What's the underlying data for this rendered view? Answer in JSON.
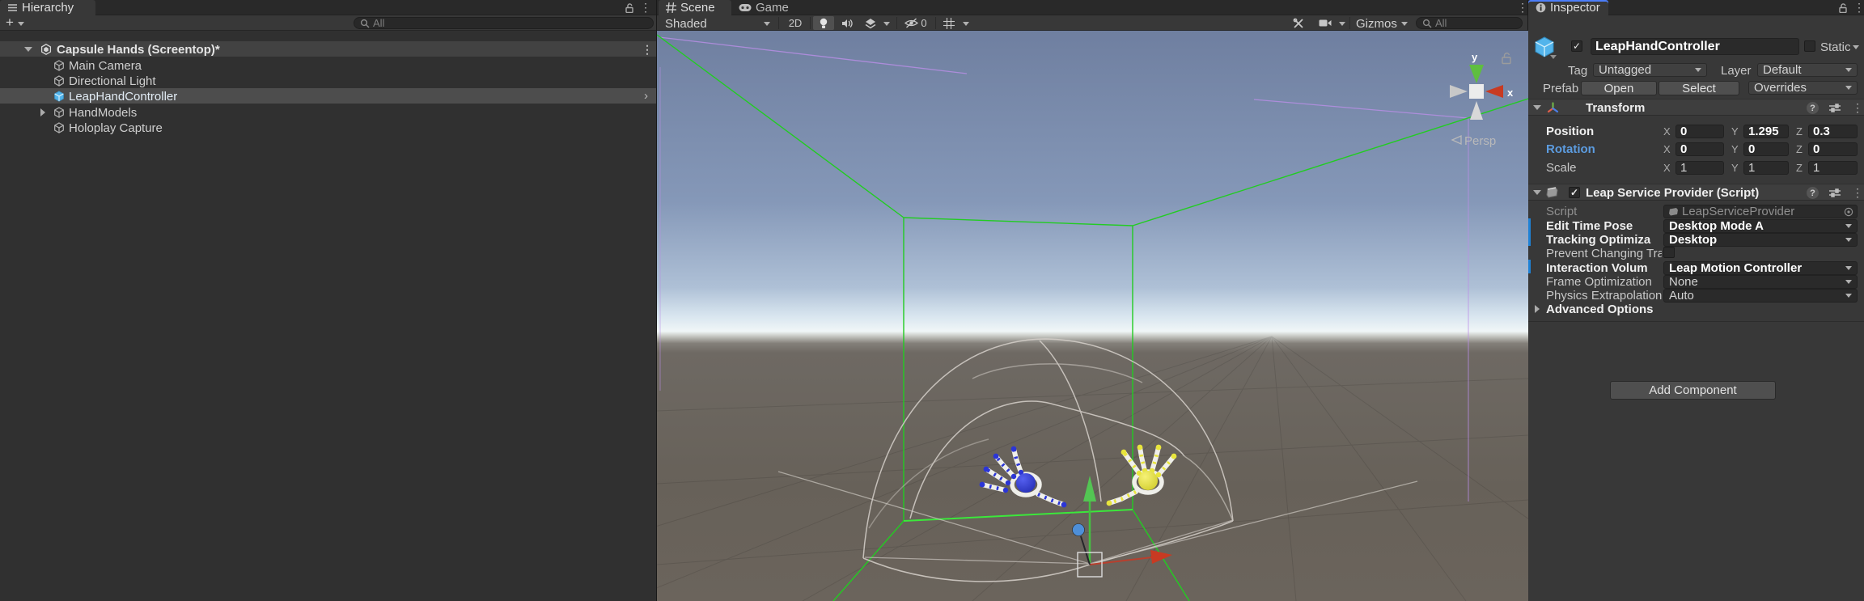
{
  "colors": {
    "accent": "#53B4EB",
    "focus_line": "#4C7EFA",
    "rotation_label": "#5C9CE0",
    "override_bar": "#1F82D6",
    "green_wire": "#22CC22",
    "green_wire_bright": "#3BE83B",
    "purple_wire": "#BB8FE8",
    "hand_blue": "#2B35D6",
    "hand_yellow": "#E8E53C",
    "axis_green": "#5FBE3F",
    "axis_red": "#C83A22",
    "axis_blue": "#4E8FD8"
  },
  "hierarchy": {
    "tab": "Hierarchy",
    "create_button": "+",
    "search_placeholder": "All",
    "scene": {
      "label": "Capsule Hands (Screentop)*"
    },
    "items": [
      {
        "label": "Main Camera"
      },
      {
        "label": "Directional Light"
      },
      {
        "label": "LeapHandController"
      },
      {
        "label": "HandModels"
      },
      {
        "label": "Holoplay Capture"
      }
    ]
  },
  "scene_view": {
    "tab_scene": "Scene",
    "tab_game": "Game",
    "toolbar": {
      "shading": "Shaded",
      "btn_2d": "2D",
      "hidden_count": "0",
      "gizmos": "Gizmos",
      "search_placeholder": "All"
    },
    "viewport": {
      "persp": "Persp",
      "axis_x": "x",
      "axis_y": "y"
    }
  },
  "inspector": {
    "tab": "Inspector",
    "header": {
      "name": "LeapHandController",
      "static": "Static",
      "tag": "Tag",
      "tag_value": "Untagged",
      "layer": "Layer",
      "layer_value": "Default",
      "prefab": "Prefab",
      "open": "Open",
      "select": "Select",
      "overrides": "Overrides"
    },
    "transform": {
      "title": "Transform",
      "axis": {
        "x": "X",
        "y": "Y",
        "z": "Z"
      },
      "position": {
        "label": "Position",
        "x": "0",
        "y": "1.295",
        "z": "0.3"
      },
      "rotation": {
        "label": "Rotation",
        "x": "0",
        "y": "0",
        "z": "0"
      },
      "scale": {
        "label": "Scale",
        "x": "1",
        "y": "1",
        "z": "1"
      }
    },
    "leap": {
      "title": "Leap Service Provider (Script)",
      "script_label": "Script",
      "script_value": "LeapServiceProvider",
      "rows": [
        {
          "label": "Edit Time Pose",
          "value": "Desktop Mode A"
        },
        {
          "label": "Tracking Optimiza",
          "value": "Desktop"
        },
        {
          "label": "Prevent Changing Tra",
          "value": ""
        },
        {
          "label": "Interaction Volum",
          "value": "Leap Motion Controller"
        },
        {
          "label": "Frame Optimization",
          "value": "None"
        },
        {
          "label": "Physics Extrapolation",
          "value": "Auto"
        }
      ],
      "advanced": "Advanced Options"
    },
    "add_component": "Add Component"
  }
}
